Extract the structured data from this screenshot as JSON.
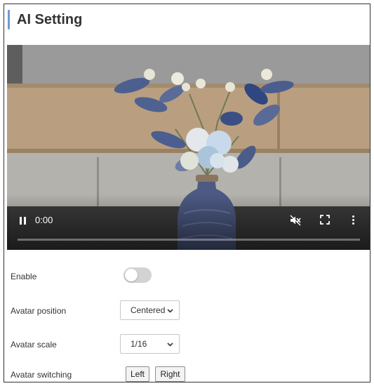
{
  "page": {
    "title": "AI Setting"
  },
  "video": {
    "current_time": "0:00",
    "progress": 0,
    "is_playing": true,
    "muted": true,
    "icons": {
      "pause": "pause-icon",
      "mute": "volume-muted-icon",
      "fullscreen": "fullscreen-icon",
      "more": "more-vertical-icon"
    }
  },
  "settings": {
    "enable": {
      "label": "Enable",
      "value": false
    },
    "avatar_position": {
      "label": "Avatar position",
      "selected": "Centered"
    },
    "avatar_scale": {
      "label": "Avatar scale",
      "selected": "1/16"
    },
    "avatar_switching": {
      "label": "Avatar switching",
      "left_label": "Left",
      "right_label": "Right"
    }
  },
  "colors": {
    "accent": "#6f9bd8",
    "toggle_off": "#d3d3d3"
  }
}
